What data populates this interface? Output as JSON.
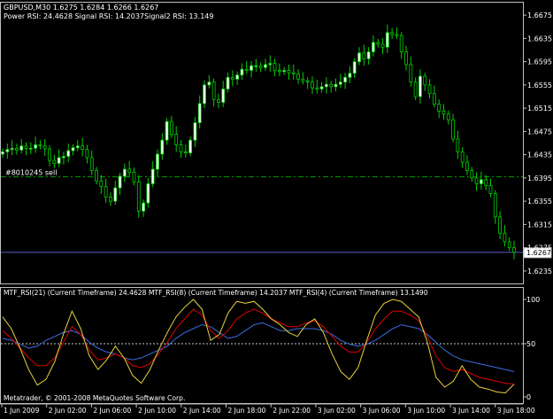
{
  "colors": {
    "background": "#000000",
    "grid": "#5a5a5a",
    "axis": "#c0c0c0",
    "text": "#ffffff",
    "bull_candle": "#ffffff",
    "bear_candle": "#000000",
    "candle_outline": "#00d000",
    "order_line": "#00a000",
    "bid_line": "#5a5ac8",
    "rsi21": "#3a6ee0",
    "rsi8": "#e00000",
    "rsi4": "#e6d23c",
    "level_line": "#c8c8c8"
  },
  "header": {
    "symbol_line": "GBPUSD,M30  1.6275 1.6284 1.6266 1.6267",
    "indicator_line": "Power RSI: 24.4628 Signal RSI: 14.2037Signal2 RSI: 13.149"
  },
  "order": {
    "label": "#8010245 sell",
    "price": 1.6397
  },
  "bid": {
    "price": 1.6267,
    "label": "1.6267"
  },
  "indicator": {
    "title": "MTF_RSI(21) (Current Timeframe) 24.4628  MTF_RSI(8) (Current Timeframe) 14.2037  MTF_RSI(4) (Current Timeframe) 13.1490",
    "levels": [
      "100",
      "50",
      "0"
    ],
    "copyright": "Metatrader, © 2001-2008 MetaQuotes Software Corp."
  },
  "chart_data": {
    "type": "candlestick",
    "price_axis": {
      "min": 1.6215,
      "max": 1.6695,
      "ticks": [
        1.6675,
        1.6635,
        1.6595,
        1.6555,
        1.6515,
        1.6475,
        1.6435,
        1.6395,
        1.6355,
        1.6315,
        1.6275,
        1.6235
      ]
    },
    "time_labels": [
      "1 Jun 2009",
      "2 Jun 02:00",
      "2 Jun 06:00",
      "2 Jun 10:00",
      "2 Jun 14:00",
      "2 Jun 18:00",
      "2 Jun 22:00",
      "3 Jun 02:00",
      "3 Jun 06:00",
      "3 Jun 10:00",
      "3 Jun 14:00",
      "3 Jun 18:00"
    ],
    "close_path": [
      1.644,
      1.6444,
      1.6446,
      1.6443,
      1.645,
      1.6446,
      1.6446,
      1.6452,
      1.645,
      1.6445,
      1.6425,
      1.642,
      1.643,
      1.6432,
      1.6442,
      1.6447,
      1.645,
      1.6444,
      1.643,
      1.6408,
      1.639,
      1.638,
      1.6362,
      1.6355,
      1.6378,
      1.6398,
      1.641,
      1.6405,
      1.6388,
      1.6338,
      1.6352,
      1.6385,
      1.641,
      1.6436,
      1.646,
      1.6492,
      1.647,
      1.6452,
      1.644,
      1.6438,
      1.646,
      1.649,
      1.6523,
      1.6555,
      1.656,
      1.653,
      1.6525,
      1.6548,
      1.6568,
      1.6565,
      1.6572,
      1.6582,
      1.658,
      1.6588,
      1.6588,
      1.6585,
      1.659,
      1.6592,
      1.658,
      1.6578,
      1.658,
      1.6576,
      1.6574,
      1.6565,
      1.6562,
      1.656,
      1.655,
      1.6548,
      1.6552,
      1.6556,
      1.6552,
      1.6556,
      1.656,
      1.6568,
      1.6575,
      1.6595,
      1.661,
      1.66,
      1.6612,
      1.6628,
      1.6625,
      1.662,
      1.6645,
      1.6642,
      1.664,
      1.6612,
      1.659,
      1.656,
      1.6535,
      1.657,
      1.6555,
      1.654,
      1.6522,
      1.651,
      1.6505,
      1.6495,
      1.6462,
      1.644,
      1.6422,
      1.6408,
      1.6395,
      1.6385,
      1.6392,
      1.6382,
      1.6368,
      1.6328,
      1.63,
      1.6285,
      1.6275,
      1.6267
    ],
    "series": [
      {
        "name": "MTF_RSI(21)",
        "values": [
          60,
          58,
          54,
          50,
          52,
          58,
          62,
          66,
          68,
          64,
          56,
          50,
          46,
          44,
          40,
          38,
          40,
          44,
          48,
          52,
          60,
          66,
          70,
          74,
          72,
          66,
          60,
          62,
          68,
          74,
          76,
          72,
          68,
          68,
          70,
          70,
          70,
          68,
          64,
          58,
          54,
          52,
          54,
          58,
          64,
          70,
          74,
          72,
          70,
          64,
          56,
          48,
          42,
          38,
          36,
          34,
          32,
          30,
          28,
          26
        ]
      },
      {
        "name": "MTF_RSI(8)",
        "values": [
          68,
          60,
          50,
          40,
          32,
          32,
          40,
          56,
          72,
          64,
          48,
          38,
          40,
          44,
          40,
          32,
          30,
          34,
          44,
          56,
          70,
          80,
          90,
          84,
          68,
          60,
          68,
          80,
          86,
          90,
          86,
          80,
          76,
          72,
          72,
          76,
          78,
          72,
          62,
          52,
          46,
          46,
          56,
          70,
          80,
          88,
          88,
          84,
          78,
          62,
          42,
          30,
          26,
          28,
          24,
          20,
          18,
          16,
          14,
          13
        ]
      },
      {
        "name": "MTF_RSI(4)",
        "values": [
          82,
          70,
          50,
          28,
          12,
          18,
          36,
          64,
          88,
          70,
          42,
          28,
          38,
          52,
          40,
          22,
          14,
          28,
          48,
          66,
          82,
          92,
          100,
          90,
          58,
          64,
          86,
          98,
          96,
          98,
          90,
          80,
          74,
          66,
          62,
          74,
          80,
          66,
          44,
          26,
          18,
          30,
          58,
          84,
          96,
          100,
          98,
          90,
          82,
          56,
          20,
          10,
          16,
          32,
          18,
          10,
          8,
          5,
          4,
          13
        ]
      }
    ]
  }
}
